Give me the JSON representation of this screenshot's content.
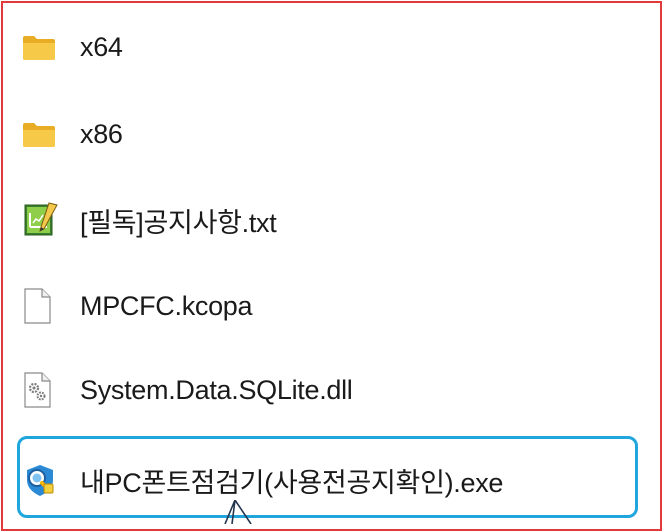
{
  "explorer": {
    "items": [
      {
        "name": "x64",
        "icon": "folder-icon",
        "type": "folder"
      },
      {
        "name": "x86",
        "icon": "folder-icon",
        "type": "folder"
      },
      {
        "name": "[필독]공지사항.txt",
        "icon": "text-file-icon",
        "type": "file"
      },
      {
        "name": "MPCFC.kcopa",
        "icon": "blank-file-icon",
        "type": "file"
      },
      {
        "name": "System.Data.SQLite.dll",
        "icon": "dll-settings-file-icon",
        "type": "file"
      },
      {
        "name": "내PC폰트점검기(사용전공지확인).exe",
        "icon": "app-exe-icon",
        "type": "file"
      }
    ],
    "highlighted_item": "내PC폰트점검기(사용전공지확인).exe"
  },
  "colors": {
    "frame_border": "#e23a3a",
    "highlight_border": "#20a6dc",
    "folder": "#f6c445"
  }
}
